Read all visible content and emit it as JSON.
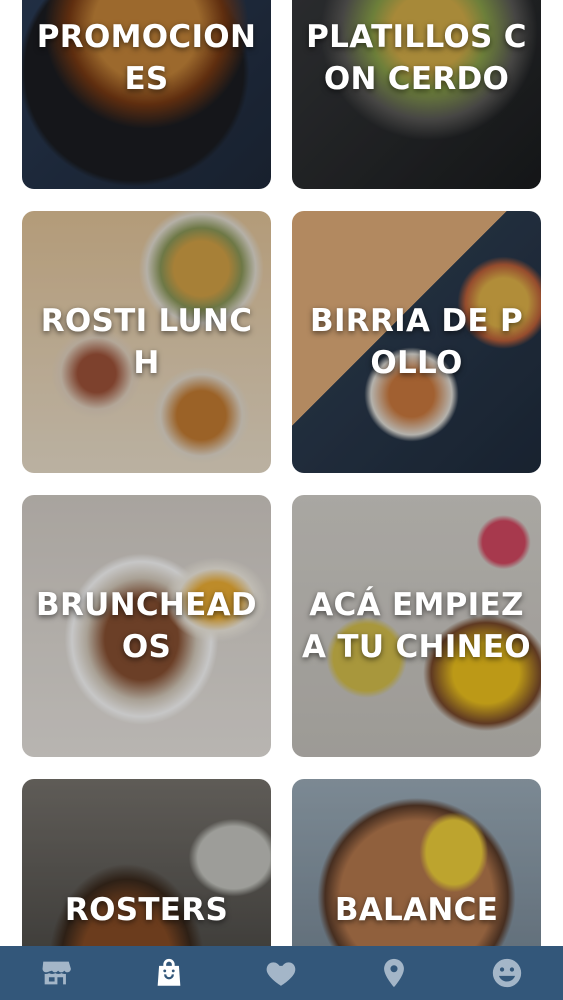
{
  "categories": [
    {
      "label": "PROMOCIONES"
    },
    {
      "label": "PLATILLOS CON CERDO"
    },
    {
      "label": "ROSTI LUNCH"
    },
    {
      "label": "BIRRIA DE POLLO"
    },
    {
      "label": "BRUNCHEADOS"
    },
    {
      "label": "ACÁ EMPIEZA TU CHINEO"
    },
    {
      "label": "ROSTERS"
    },
    {
      "label": "BALANCE"
    }
  ],
  "bottom_nav": {
    "background": "#33577a",
    "items": [
      {
        "icon": "store-icon",
        "active": false
      },
      {
        "icon": "shopping-bag-icon",
        "active": true
      },
      {
        "icon": "heart-icon",
        "active": false
      },
      {
        "icon": "location-pin-icon",
        "active": false
      },
      {
        "icon": "smiley-face-icon",
        "active": false
      }
    ]
  }
}
